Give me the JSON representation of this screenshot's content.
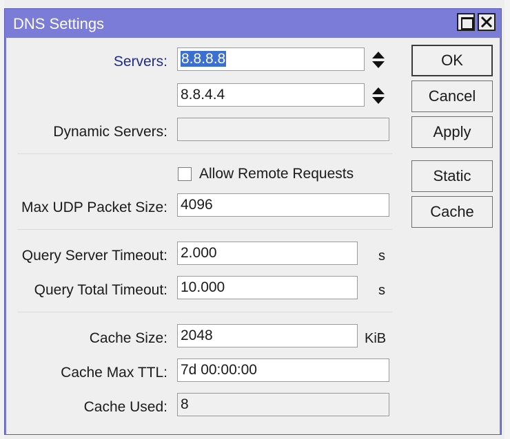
{
  "window": {
    "title": "DNS Settings"
  },
  "form": {
    "servers_label": "Servers:",
    "server_1": "8.8.8.8",
    "server_2": "8.8.4.4",
    "dynamic_servers_label": "Dynamic Servers:",
    "dynamic_servers_value": "",
    "allow_remote_label": "Allow Remote Requests",
    "allow_remote_checked": false,
    "max_udp_label": "Max UDP Packet Size:",
    "max_udp_value": "4096",
    "query_server_timeout_label": "Query Server Timeout:",
    "query_server_timeout_value": "2.000",
    "query_server_timeout_unit": "s",
    "query_total_timeout_label": "Query Total Timeout:",
    "query_total_timeout_value": "10.000",
    "query_total_timeout_unit": "s",
    "cache_size_label": "Cache Size:",
    "cache_size_value": "2048",
    "cache_size_unit": "KiB",
    "cache_max_ttl_label": "Cache Max TTL:",
    "cache_max_ttl_value": "7d 00:00:00",
    "cache_used_label": "Cache Used:",
    "cache_used_value": "8"
  },
  "buttons": {
    "ok": "OK",
    "cancel": "Cancel",
    "apply": "Apply",
    "static": "Static",
    "cache": "Cache"
  },
  "icons": {
    "maximize": "maximize-icon",
    "close": "close-icon",
    "updown": "up-down-arrows-icon"
  },
  "colors": {
    "titlebar": "#7b7bd8",
    "selection": "#3b6fd0",
    "label_accent": "#1f2a8a"
  }
}
